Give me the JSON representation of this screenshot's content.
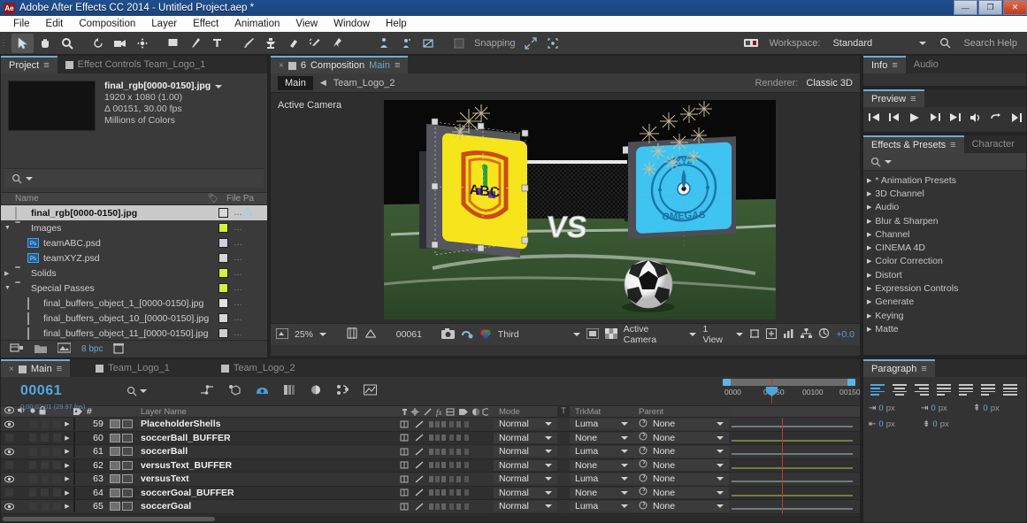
{
  "window": {
    "title": "Adobe After Effects CC 2014 - Untitled Project.aep *",
    "app_badge": "Ae",
    "minimize": "—",
    "maximize": "❐",
    "close": "✕"
  },
  "menubar": [
    "File",
    "Edit",
    "Composition",
    "Layer",
    "Effect",
    "Animation",
    "View",
    "Window",
    "Help"
  ],
  "toolbar": {
    "snapping_label": "Snapping",
    "workspace_label": "Workspace:",
    "workspace_value": "Standard",
    "search_help": "Search Help",
    "tools": [
      "selection-tool",
      "hand-tool",
      "zoom-tool",
      "rotation-tool",
      "camera-tool",
      "pan-behind-tool",
      "shape-tool",
      "pen-tool",
      "type-tool",
      "brush-tool",
      "clone-stamp-tool",
      "eraser-tool",
      "roto-brush-tool",
      "puppet-pin-tool"
    ]
  },
  "project_panel": {
    "tabs": [
      {
        "label": "Project",
        "active": true
      },
      {
        "label": "Effect Controls Team_Logo_1",
        "active": false
      }
    ],
    "selected_item": {
      "name": "final_rgb[0000-0150].jpg",
      "dimensions": "1920 x 1080  (1.00)",
      "duration": "Δ 00151, 30.00 fps",
      "color_depth": "Millions of Colors"
    },
    "columns": {
      "name": "Name",
      "tag": "tag-icon",
      "file_path": "File Pa"
    },
    "items": [
      {
        "name": "final_rgb[0000-0150].jpg",
        "type": "footage",
        "indent": 0,
        "selected": true,
        "swatch": "#d8d8d8",
        "twirl": ""
      },
      {
        "name": "Images",
        "type": "folder",
        "indent": 0,
        "selected": false,
        "swatch": "#d6f03a",
        "twirl": "▼"
      },
      {
        "name": "teamABC.psd",
        "type": "psd",
        "indent": 1,
        "selected": false,
        "swatch": "#cfcfe0",
        "twirl": ""
      },
      {
        "name": "teamXYZ.psd",
        "type": "psd",
        "indent": 1,
        "selected": false,
        "swatch": "#d6d6d6",
        "twirl": ""
      },
      {
        "name": "Solids",
        "type": "folder",
        "indent": 0,
        "selected": false,
        "swatch": "#d6f03a",
        "twirl": "▶"
      },
      {
        "name": "Special Passes",
        "type": "folder",
        "indent": 0,
        "selected": false,
        "swatch": "#d6f03a",
        "twirl": "▼"
      },
      {
        "name": "final_buffers_object_1_[0000-0150].jpg",
        "type": "footage",
        "indent": 1,
        "selected": false,
        "swatch": "#e2e2e2",
        "twirl": ""
      },
      {
        "name": "final_buffers_object_10_[0000-0150].jpg",
        "type": "footage",
        "indent": 1,
        "selected": false,
        "swatch": "#d6d6d6",
        "twirl": ""
      },
      {
        "name": "final_buffers_object_11_[0000-0150].jpg",
        "type": "footage",
        "indent": 1,
        "selected": false,
        "swatch": "#cfcfcf",
        "twirl": ""
      }
    ],
    "footer": {
      "bpc": "8 bpc"
    }
  },
  "comp_panel": {
    "tab": {
      "label": "Composition",
      "comp_name": "Main",
      "count": "6"
    },
    "chip": "Main",
    "secondary_comp": "Team_Logo_2",
    "renderer_label": "Renderer:",
    "renderer_value": "Classic 3D",
    "view_label": "Active Camera",
    "footer": {
      "zoom": "25%",
      "timecode": "00061",
      "resolution": "Third",
      "camera": "Active Camera",
      "views": "1 View",
      "exposure": "+0.0"
    },
    "stage": {
      "versus_text": "VS",
      "team_left": "ABC",
      "team_right_1": "XYZ",
      "team_right_2": "OMEGAS"
    }
  },
  "info_panel": {
    "tabs": [
      "Info",
      "Audio"
    ]
  },
  "preview_panel": {
    "tab": "Preview",
    "buttons": [
      "first-frame",
      "prev-frame",
      "play",
      "next-frame",
      "last-frame",
      "audio",
      "loop",
      "ram-preview"
    ]
  },
  "effects_panel": {
    "tabs": [
      "Effects & Presets",
      "Character"
    ],
    "items": [
      "* Animation Presets",
      "3D Channel",
      "Audio",
      "Blur & Sharpen",
      "Channel",
      "CINEMA 4D",
      "Color Correction",
      "Distort",
      "Expression Controls",
      "Generate",
      "Keying",
      "Matte"
    ]
  },
  "paragraph_panel": {
    "tab": "Paragraph",
    "align_buttons": [
      "align-left",
      "align-center",
      "align-right",
      "justify-last-left",
      "justify-last-center",
      "justify-last-right",
      "justify-all"
    ],
    "fields": [
      {
        "icon": "indent-left",
        "value": "0",
        "unit": "px"
      },
      {
        "icon": "indent-first-line",
        "value": "0",
        "unit": "px"
      },
      {
        "icon": "space-before",
        "value": "0",
        "unit": "px"
      },
      {
        "icon": "indent-right",
        "value": "0",
        "unit": "px"
      },
      {
        "icon": "space-after",
        "value": "0",
        "unit": "px"
      }
    ]
  },
  "timeline": {
    "tabs": [
      {
        "label": "Main",
        "active": true
      },
      {
        "label": "Team_Logo_1",
        "active": false
      },
      {
        "label": "Team_Logo_2",
        "active": false
      }
    ],
    "current_time": "00061",
    "current_time_sub": "0;00;02;01 (29.97 fps)",
    "ruler_ticks": [
      "0000",
      "00050",
      "00100",
      "00150"
    ],
    "columns": {
      "layer_name": "Layer Name",
      "mode": "Mode",
      "t": "T",
      "trkmat": "TrkMat",
      "parent": "Parent"
    },
    "layers": [
      {
        "num": "59",
        "name": "PlaceholderShells",
        "label_color": "#b9d4e4",
        "mode": "Normal",
        "trkmat": "Luma",
        "parent": "None",
        "bar_color": "#a9bfc4",
        "visible": true
      },
      {
        "num": "60",
        "name": "soccerBall_BUFFER",
        "label_color": "#e3ec59",
        "mode": "Normal",
        "trkmat": "None",
        "parent": "None",
        "bar_color": "#b5bd63",
        "visible": false
      },
      {
        "num": "61",
        "name": "soccerBall",
        "label_color": "#b9d4e4",
        "mode": "Normal",
        "trkmat": "Luma",
        "parent": "None",
        "bar_color": "#a9bfc4",
        "visible": true
      },
      {
        "num": "62",
        "name": "versusText_BUFFER",
        "label_color": "#e3ec59",
        "mode": "Normal",
        "trkmat": "None",
        "parent": "None",
        "bar_color": "#b5bd63",
        "visible": false
      },
      {
        "num": "63",
        "name": "versusText",
        "label_color": "#b9d4e4",
        "mode": "Normal",
        "trkmat": "Luma",
        "parent": "None",
        "bar_color": "#a9bfc4",
        "visible": true
      },
      {
        "num": "64",
        "name": "soccerGoal_BUFFER",
        "label_color": "#e3ec59",
        "mode": "Normal",
        "trkmat": "None",
        "parent": "None",
        "bar_color": "#b5bd63",
        "visible": false
      },
      {
        "num": "65",
        "name": "soccerGoal",
        "label_color": "#b9d4e4",
        "mode": "Normal",
        "trkmat": "Luma",
        "parent": "None",
        "bar_color": "#a9bfc4",
        "visible": true
      }
    ]
  }
}
